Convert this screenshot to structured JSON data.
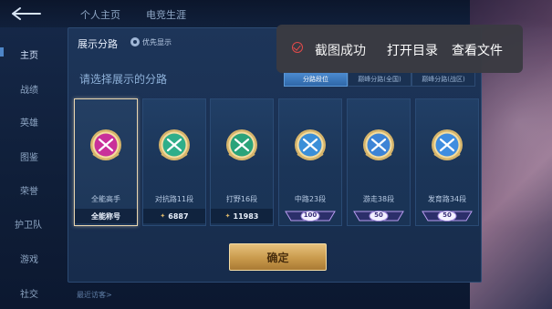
{
  "top_nav": {
    "tab1": "个人主页",
    "tab2": "电竞生涯"
  },
  "sidebar": {
    "items": [
      {
        "label": "主页"
      },
      {
        "label": "战绩"
      },
      {
        "label": "英雄"
      },
      {
        "label": "图鉴"
      },
      {
        "label": "荣誉"
      },
      {
        "label": "护卫队"
      },
      {
        "label": "游戏"
      },
      {
        "label": "社交"
      }
    ]
  },
  "panel": {
    "title": "展示分路",
    "priority_label": "优先显示",
    "prompt": "请选择展示的分路",
    "segments": [
      "分路段位",
      "巅峰分路(全国)",
      "巅峰分路(战区)"
    ],
    "confirm_label": "确定",
    "footer_link": "最近访客>"
  },
  "cards": [
    {
      "label": "全能高手",
      "foot": "全能称号",
      "foot_type": "text",
      "color": "#c9309a"
    },
    {
      "label": "对抗路11段",
      "foot": "6887",
      "foot_type": "score",
      "color": "#2fae8a"
    },
    {
      "label": "打野16段",
      "foot": "11983",
      "foot_type": "score",
      "color": "#2aa37a"
    },
    {
      "label": "中路23段",
      "foot": "100",
      "foot_type": "rank",
      "color": "#3b8fd8"
    },
    {
      "label": "游走38段",
      "foot": "50",
      "foot_type": "rank",
      "color": "#3d84d6"
    },
    {
      "label": "发育路34段",
      "foot": "50",
      "foot_type": "rank",
      "color": "#3f8de0"
    }
  ],
  "toast": {
    "message": "截图成功",
    "open_dir": "打开目录",
    "view_file": "查看文件"
  },
  "colors": {
    "accent_gold": "#e6c17d",
    "toast_bg": "#3a3a42",
    "error_red": "#e24a4a"
  }
}
